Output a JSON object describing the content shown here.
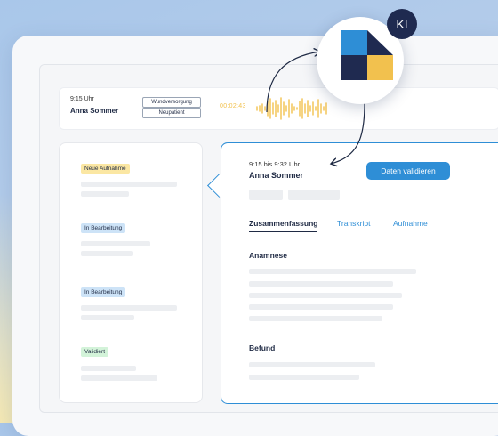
{
  "ai_badge": "KI",
  "patient_bar": {
    "time": "9:15 Uhr",
    "name": "Anna Sommer",
    "tags": [
      "Wundversorgung",
      "Neupatient"
    ],
    "timer": "00:02:43"
  },
  "left_panel": {
    "statuses": [
      {
        "label": "Neue Aufnahme",
        "color": "#fbe7a3"
      },
      {
        "label": "In Bearbeitung",
        "color": "#cde3f7"
      },
      {
        "label": "In Bearbeitung",
        "color": "#cde3f7"
      },
      {
        "label": "Validiert",
        "color": "#d3f3d9"
      }
    ]
  },
  "main_panel": {
    "time": "9:15 bis 9:32 Uhr",
    "name": "Anna Sommer",
    "validate_button": "Daten validieren",
    "tabs": [
      "Zusammenfassung",
      "Transkript",
      "Aufnahme"
    ],
    "sections": [
      "Anamnese",
      "Befund"
    ]
  },
  "colors": {
    "accent": "#2e8ed6",
    "navy": "#1f2a50",
    "yellow": "#f2c14e"
  }
}
